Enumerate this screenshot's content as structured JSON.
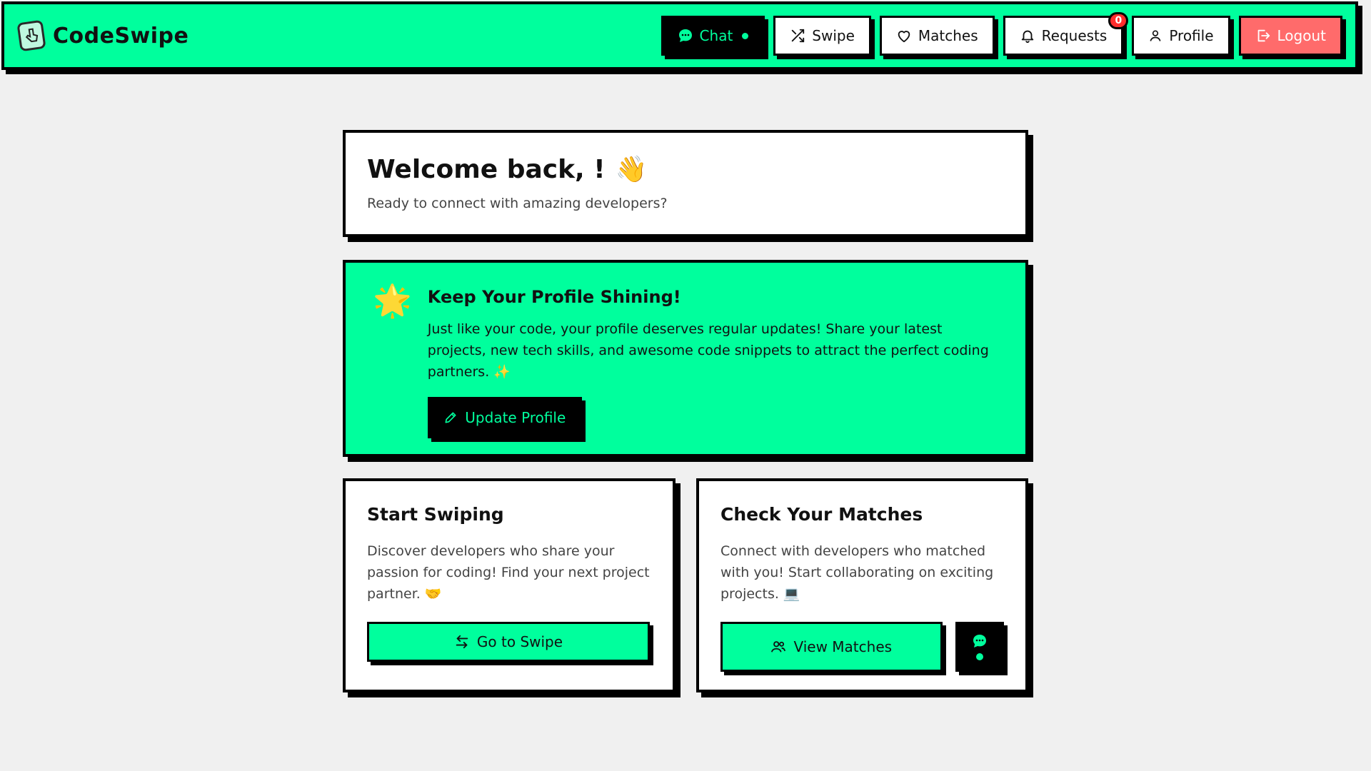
{
  "app": {
    "name": "CodeSwipe",
    "logo_icon": "pointer-hand-card-icon"
  },
  "nav": {
    "chat": {
      "label": "Chat",
      "icon": "chat-bubble-icon",
      "online": true
    },
    "swipe": {
      "label": "Swipe",
      "icon": "shuffle-icon"
    },
    "matches": {
      "label": "Matches",
      "icon": "heart-icon"
    },
    "requests": {
      "label": "Requests",
      "icon": "bell-icon",
      "badge": "0"
    },
    "profile": {
      "label": "Profile",
      "icon": "user-icon"
    },
    "logout": {
      "label": "Logout",
      "icon": "logout-icon"
    }
  },
  "welcome": {
    "title": "Welcome back, !",
    "emoji": "👋",
    "subtitle": "Ready to connect with amazing developers?"
  },
  "tip": {
    "emoji": "🌟",
    "title": "Keep Your Profile Shining!",
    "text": "Just like your code, your profile deserves regular updates! Share your latest projects, new tech skills, and awesome code snippets to attract the perfect coding partners. ✨",
    "button_label": "Update Profile",
    "button_icon": "pencil-icon"
  },
  "swipe_card": {
    "title": "Start Swiping",
    "text": "Discover developers who share your passion for coding! Find your next project partner. 🤝",
    "button_label": "Go to Swipe",
    "button_icon": "swap-arrows-icon"
  },
  "matches_card": {
    "title": "Check Your Matches",
    "text": "Connect with developers who matched with you! Start collaborating on exciting projects. 💻",
    "button_label": "View Matches",
    "button_icon": "users-icon",
    "chat_button_icon": "chat-bubble-icon"
  },
  "colors": {
    "accent": "#00ff9d",
    "background": "#f0f0f0",
    "logout": "#ff6b6b",
    "badge": "#ff2d2d",
    "ink": "#000000"
  }
}
